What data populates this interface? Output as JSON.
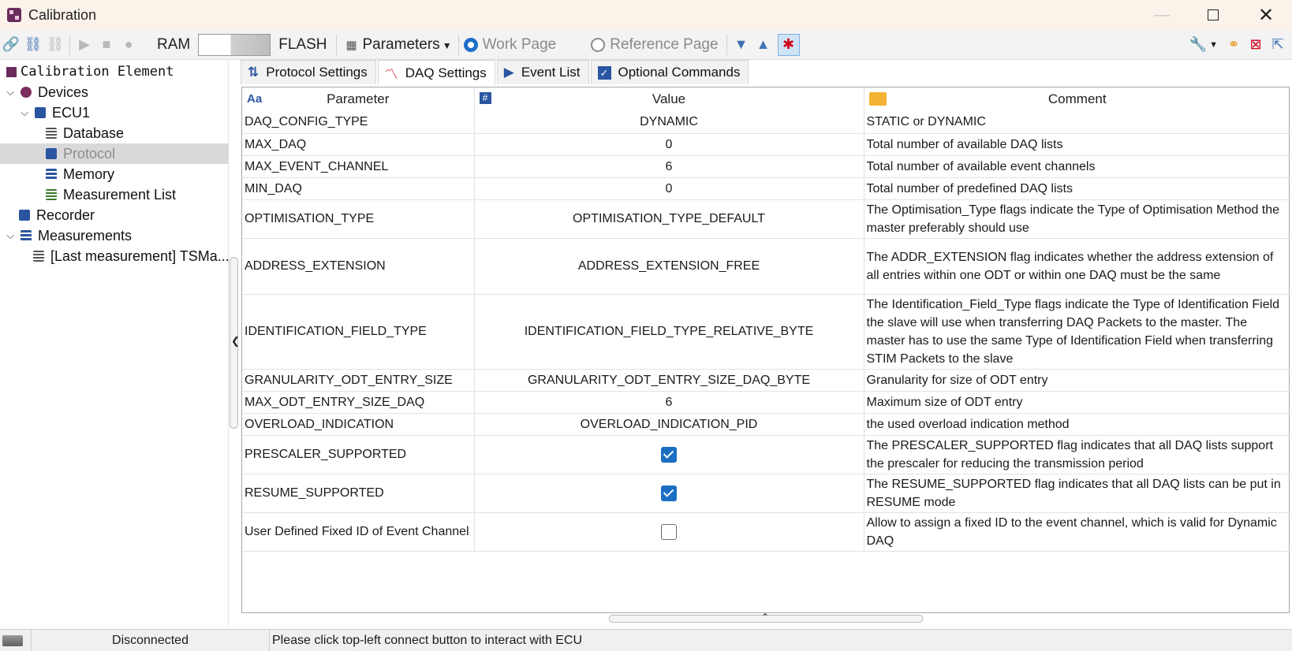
{
  "window": {
    "title": "Calibration"
  },
  "toolbar": {
    "ram_label": "RAM",
    "flash_label": "FLASH",
    "parameters_label": "Parameters",
    "work_page_label": "Work Page",
    "reference_page_label": "Reference Page"
  },
  "tree": {
    "root_label": "Calibration Element",
    "items": [
      {
        "label": "Devices"
      },
      {
        "label": "ECU1"
      },
      {
        "label": "Database"
      },
      {
        "label": "Protocol"
      },
      {
        "label": "Memory"
      },
      {
        "label": "Measurement List"
      },
      {
        "label": "Recorder"
      },
      {
        "label": "Measurements"
      },
      {
        "label": "[Last measurement] TSMa..."
      }
    ]
  },
  "tabs": [
    {
      "label": "Protocol Settings"
    },
    {
      "label": "DAQ Settings"
    },
    {
      "label": "Event List"
    },
    {
      "label": "Optional Commands"
    }
  ],
  "table": {
    "headers": {
      "parameter": "Parameter",
      "value": "Value",
      "comment": "Comment"
    },
    "rows": [
      {
        "parameter": "DAQ_CONFIG_TYPE",
        "value": "DYNAMIC",
        "comment": "STATIC or DYNAMIC"
      },
      {
        "parameter": "MAX_DAQ",
        "value": "0",
        "comment": "Total number of available DAQ lists"
      },
      {
        "parameter": "MAX_EVENT_CHANNEL",
        "value": "6",
        "comment": "Total number of available event channels"
      },
      {
        "parameter": "MIN_DAQ",
        "value": "0",
        "comment": "Total number of predefined DAQ lists"
      },
      {
        "parameter": "OPTIMISATION_TYPE",
        "value": "OPTIMISATION_TYPE_DEFAULT",
        "comment": "The Optimisation_Type flags indicate the Type of Optimisation Method the master preferably should use"
      },
      {
        "parameter": "ADDRESS_EXTENSION",
        "value": "ADDRESS_EXTENSION_FREE",
        "comment": "The ADDR_EXTENSION flag indicates whether the address extension of all entries within one ODT or within one DAQ must be the same"
      },
      {
        "parameter": "IDENTIFICATION_FIELD_TYPE",
        "value": "IDENTIFICATION_FIELD_TYPE_RELATIVE_BYTE",
        "comment": "The Identification_Field_Type flags indicate the Type of Identification Field the slave will use when transferring DAQ Packets to the master. The master has to use the same Type of Identification Field when transferring STIM Packets to the slave"
      },
      {
        "parameter": "GRANULARITY_ODT_ENTRY_SIZE",
        "value": "GRANULARITY_ODT_ENTRY_SIZE_DAQ_BYTE",
        "comment": "Granularity for size of ODT entry"
      },
      {
        "parameter": "MAX_ODT_ENTRY_SIZE_DAQ",
        "value": "6",
        "comment": "Maximum size of ODT entry"
      },
      {
        "parameter": "OVERLOAD_INDICATION",
        "value": "OVERLOAD_INDICATION_PID",
        "comment": "the used overload indication method"
      },
      {
        "parameter": "PRESCALER_SUPPORTED",
        "checked": true,
        "comment": "The PRESCALER_SUPPORTED flag indicates that all DAQ lists support the prescaler for reducing the transmission period"
      },
      {
        "parameter": "RESUME_SUPPORTED",
        "checked": true,
        "comment": "The RESUME_SUPPORTED flag indicates that all DAQ lists can be put in RESUME mode"
      },
      {
        "parameter": "User Defined Fixed ID of Event Channel",
        "checked": false,
        "comment": "Allow to assign a fixed ID to the event channel, which is valid for Dynamic DAQ"
      }
    ]
  },
  "status": {
    "connection": "Disconnected",
    "message": "Please click top-left connect button to interact with ECU"
  },
  "colors": {
    "accent": "#1f6fc7",
    "debug": "#d0021b"
  }
}
